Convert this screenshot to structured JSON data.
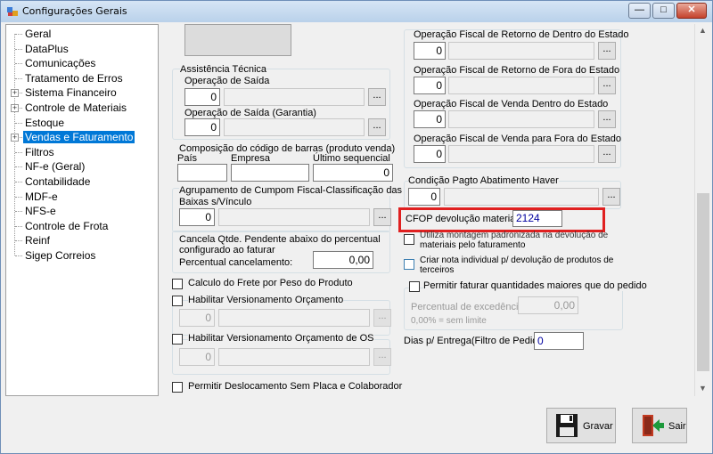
{
  "window": {
    "title": "Configurações Gerais",
    "controls": {
      "minimize": "—",
      "maximize": "□",
      "close": "✕"
    }
  },
  "tree": {
    "items": [
      {
        "label": "Geral",
        "expandable": false
      },
      {
        "label": "DataPlus",
        "expandable": false
      },
      {
        "label": "Comunicações",
        "expandable": false
      },
      {
        "label": "Tratamento de Erros",
        "expandable": false
      },
      {
        "label": "Sistema Financeiro",
        "expandable": true
      },
      {
        "label": "Controle de Materiais",
        "expandable": true
      },
      {
        "label": "Estoque",
        "expandable": false
      },
      {
        "label": "Vendas e Faturamento",
        "expandable": true,
        "selected": true
      },
      {
        "label": "Filtros",
        "expandable": false
      },
      {
        "label": "NF-e (Geral)",
        "expandable": false
      },
      {
        "label": "Contabilidade",
        "expandable": false
      },
      {
        "label": "MDF-e",
        "expandable": false
      },
      {
        "label": "NFS-e",
        "expandable": false
      },
      {
        "label": "Controle de Frota",
        "expandable": false
      },
      {
        "label": "Reinf",
        "expandable": false
      },
      {
        "label": "Sigep Correios",
        "expandable": false
      }
    ]
  },
  "left": {
    "assist": {
      "title": "Assistência Técnica",
      "saida_label": "Operação de Saída",
      "saida_value": "0",
      "garantia_label": "Operação de Saída (Garantia)",
      "garantia_value": "0",
      "ellipsis": "..."
    },
    "barcode": {
      "title": "Composição do código de barras (produto venda)",
      "pais_label": "País",
      "empresa_label": "Empresa",
      "ultimo_label": "Último sequencial",
      "pais_value": "",
      "empresa_value": "",
      "ultimo_value": "0"
    },
    "cupom": {
      "title_line1": "Agrupamento de Cumpom Fiscal-Classificação das",
      "title_line2": "Baixas s/Vínculo",
      "value": "0",
      "ellipsis": "..."
    },
    "cancela": {
      "line1": "Cancela Qtde. Pendente abaixo do percentual",
      "line2": "configurado ao faturar",
      "percent_label": "Percentual cancelamento:",
      "percent_value": "0,00"
    },
    "frete_label": "Calculo do Frete por Peso do Produto",
    "versionamento": {
      "label": "Habilitar Versionamento Orçamento",
      "value": "0",
      "ellipsis": "..."
    },
    "versionamento_os": {
      "label": "Habilitar Versionamento Orçamento de OS",
      "value": "0",
      "ellipsis": "..."
    },
    "deslocamento_label": "Permitir Deslocamento Sem Placa e Colaborador"
  },
  "right": {
    "ops": [
      {
        "label": "Operação Fiscal de Retorno de Dentro do Estado",
        "value": "0"
      },
      {
        "label": "Operação Fiscal de Retorno de Fora do Estado",
        "value": "0"
      },
      {
        "label": "Operação Fiscal de Venda Dentro do Estado",
        "value": "0"
      },
      {
        "label": "Operação Fiscal de Venda para Fora do Estado",
        "value": "0"
      }
    ],
    "ellipsis": "...",
    "condicao": {
      "label": "Condição Pagto Abatimento Haver",
      "value": "0"
    },
    "cfop": {
      "label": "CFOP devolução materiais:",
      "value": "2124"
    },
    "montagem_line1": "Utiliza montagem padronizada na devolução de",
    "montagem_line2": "materiais pelo faturamento",
    "criar_line1": "Criar nota individual p/ devolução de produtos de",
    "criar_line2": "terceiros",
    "faturar": {
      "label": "Permitir faturar quantidades maiores que do pedido",
      "excedencia_label": "Percentual de excedência:",
      "excedencia_value": "0,00",
      "hint": "0,00% = sem limite"
    },
    "dias": {
      "label": "Dias p/ Entrega(Filtro de Pedido):",
      "value": "0"
    }
  },
  "buttons": {
    "gravar": "Gravar",
    "sair": "Sair"
  },
  "colors": {
    "selection": "#0078d7",
    "highlight": "#e02020"
  }
}
